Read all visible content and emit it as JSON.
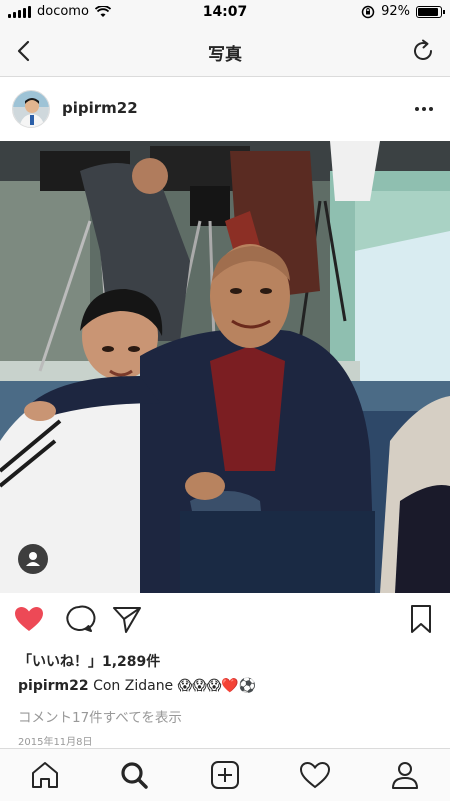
{
  "status_bar": {
    "carrier": "docomo",
    "time": "14:07",
    "battery": "92%",
    "battery_level": 0.92
  },
  "nav": {
    "title": "写真"
  },
  "post": {
    "username": "pipirm22",
    "likes": "「いいね！」1,289件",
    "caption_user": "pipirm22",
    "caption_text": "Con Zidane 😱😱😱❤️⚽",
    "comments_link": "コメント17件すべてを表示",
    "date": "2015年11月8日"
  },
  "colors": {
    "like_red": "#ed4956",
    "text": "#262626",
    "muted": "#999999"
  },
  "icons": {
    "back": "chevron-left-icon",
    "refresh": "refresh-icon",
    "more": "more-horizontal-icon",
    "like": "heart-filled-icon",
    "comment": "comment-bubble-icon",
    "share": "paper-plane-icon",
    "save": "bookmark-icon",
    "home": "home-icon",
    "search": "search-icon",
    "add": "plus-square-icon",
    "activity": "heart-outline-icon",
    "profile": "person-icon",
    "user_tag": "person-tag-icon"
  }
}
